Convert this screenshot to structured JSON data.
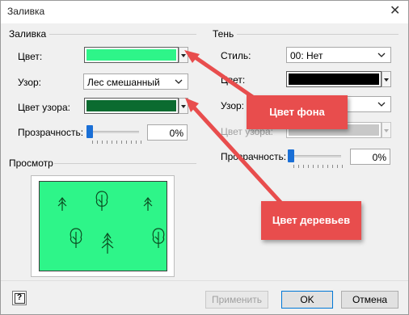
{
  "window": {
    "title": "Заливка",
    "close_glyph": "✕"
  },
  "fill": {
    "section_title": "Заливка",
    "color_label": "Цвет:",
    "color_value": "#2ef589",
    "pattern_label": "Узор:",
    "pattern_value": "Лес смешанный",
    "pattern_color_label": "Цвет узора:",
    "pattern_color_value": "#0b6b30",
    "transparency_label": "Прозрачность:",
    "transparency_value": "0%",
    "transparency_level": 0
  },
  "shadow": {
    "section_title": "Тень",
    "style_label": "Стиль:",
    "style_value": "00: Нет",
    "color_label": "Цвет:",
    "color_value": "#000000",
    "pattern_label": "Узор:",
    "pattern_value": "",
    "pattern_color_label": "Цвет узора:",
    "pattern_color_value": "#c8c8c8",
    "transparency_label": "Прозрачность:",
    "transparency_value": "0%",
    "transparency_level": 0
  },
  "preview": {
    "section_title": "Просмотр",
    "background_color": "#2ef589",
    "tree_color": "#0b4d22"
  },
  "buttons": {
    "help": "?",
    "apply": "Применить",
    "ok": "OK",
    "cancel": "Отмена"
  },
  "callouts": {
    "background_color": "Цвет фона",
    "tree_color": "Цвет деревьев",
    "accent": "#e84d4d"
  }
}
